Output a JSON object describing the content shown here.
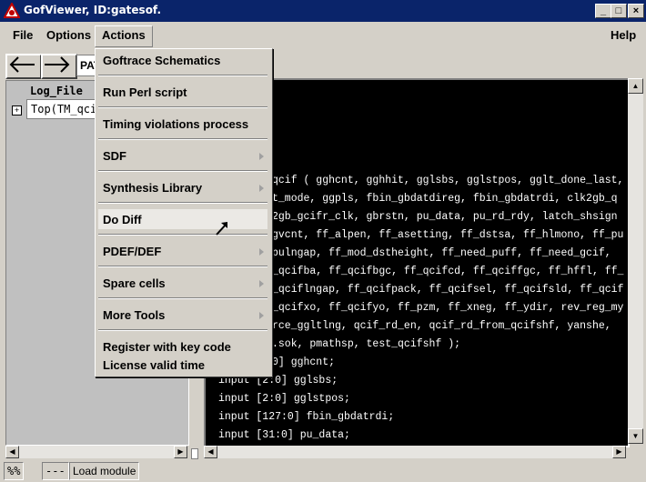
{
  "window": {
    "title": "GofViewer, ID:gatesof."
  },
  "menubar": {
    "file": "File",
    "options": "Options",
    "actions": "Actions",
    "help": "Help"
  },
  "toolbar": {
    "path_field": "PAT"
  },
  "tree": {
    "header": "Log_File",
    "item": "Top(TM_qcif"
  },
  "actions_menu": [
    {
      "label": "Goftrace Schematics",
      "submenu": false
    },
    {
      "label": "Run Perl script",
      "submenu": false
    },
    {
      "label": "Timing violations process",
      "submenu": false
    },
    {
      "label": "SDF",
      "submenu": true
    },
    {
      "label": "Synthesis Library",
      "submenu": true
    },
    {
      "label": "Do Diff",
      "submenu": false
    },
    {
      "label": "PDEF/DEF",
      "submenu": true
    },
    {
      "label": "Spare cells",
      "submenu": true
    },
    {
      "label": "More Tools",
      "submenu": true
    },
    {
      "label": "Register with key code",
      "submenu": false
    },
    {
      "label": "License valid time",
      "submenu": false
    }
  ],
  "code_lines": [
    "qcif ( gghcnt, gghhit, gglsbs, gglstpos, gglt_done_last,",
    "t_mode, ggpls, fbin_gbdatdireg, fbin_gbdatrdi, clk2gb_q",
    "2gb_gcifr_clk, gbrstn, pu_data, pu_rd_rdy, latch_shsign",
    "gvcnt, ff_alpen, ff_asetting, ff_dstsa, ff_hlmono, ff_pu",
    "pulngap, ff_mod_dstheight, ff_need_puff, ff_need_gcif,",
    "_qcifba, ff_qcifbgc, ff_qcifcd, ff_qciffgc, ff_hffl, ff_",
    "_qciflngap, ff_qcifpack, ff_qcifsel, ff_qcifsld, ff_qcif",
    "_qcifxo, ff_qcifyo, ff_pzm, ff_xneg, ff_ydir, rev_reg_my",
    "rce_ggltlng, qcif_rd_en, qcif_rd_from_qcifshf, yanshe,",
    ".sok, pmathsp, test_qcifshf );",
    "0] gghcnt;",
    "input [2:0] gglsbs;",
    "input [2:0] gglstpos;",
    "input [127:0] fbin_gbdatrdi;",
    "input [31:0] pu_data;"
  ],
  "statusbar": {
    "percent": "%%",
    "dashes": "---",
    "module": "Load module"
  }
}
